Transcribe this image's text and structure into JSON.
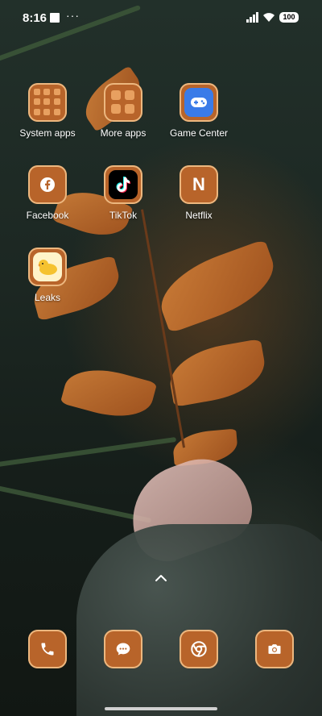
{
  "status_bar": {
    "time": "8:16",
    "more": "···",
    "battery": "100"
  },
  "apps": [
    {
      "label": "System apps",
      "icon": "folder-icon"
    },
    {
      "label": "More apps",
      "icon": "folder-icon"
    },
    {
      "label": "Game Center",
      "icon": "game-controller-icon"
    },
    {
      "label": "Facebook",
      "icon": "facebook-icon"
    },
    {
      "label": "TikTok",
      "icon": "tiktok-icon"
    },
    {
      "label": "Netflix",
      "icon": "netflix-icon",
      "glyph": "N"
    },
    {
      "label": "Leaks",
      "icon": "duck-icon"
    }
  ],
  "dock": [
    {
      "icon": "phone-icon"
    },
    {
      "icon": "messages-icon"
    },
    {
      "icon": "chrome-icon"
    },
    {
      "icon": "camera-icon"
    }
  ],
  "colors": {
    "icon_bg": "#b8642a",
    "icon_border": "#ecb77f",
    "accent": "#e8a060"
  }
}
